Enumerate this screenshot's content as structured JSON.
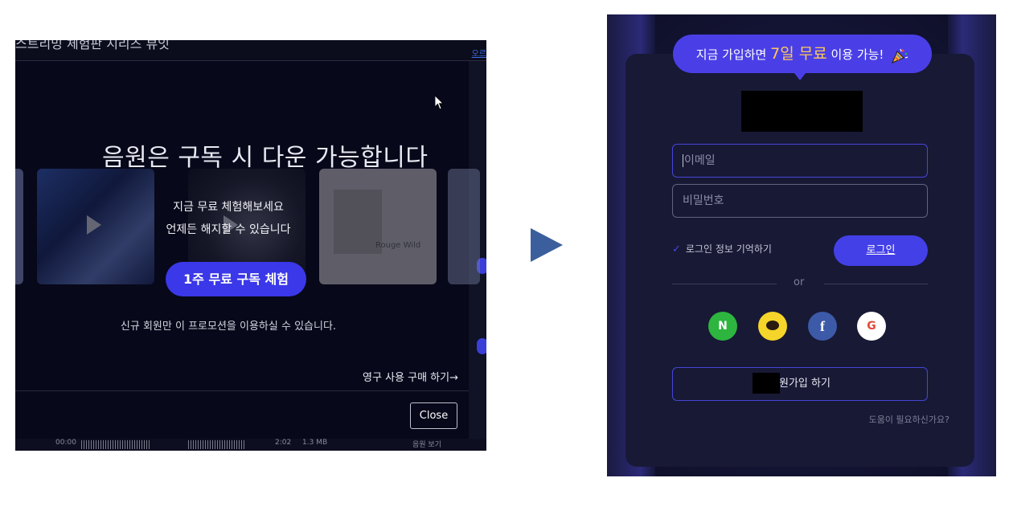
{
  "left_panel": {
    "top_title": "스트리밍 체험판 시리즈 뷰잇",
    "side_link": "오르",
    "headline": "음원은 구독 시 다운 가능합니다",
    "subtext_1": "지금 무료 체험해보세요",
    "subtext_2": "언제든 해지할 수 있습니다",
    "trial_button": "1주 무료 구독 체험",
    "promo_note": "신규 회원만 이 프로모션을 이용하실 수 있습니다.",
    "buy_link": "영구 사용 구매 하기→",
    "close_button": "Close",
    "album_3_label": "Rouge Wild",
    "bottom_time_left": "00:00",
    "bottom_time_mid": "2:02",
    "bottom_size": "1.3 MB",
    "bottom_right": "음원 보기"
  },
  "right_panel": {
    "promo_prefix": "지금 가입하면 ",
    "promo_highlight": "7일 무료",
    "promo_suffix": " 이용 가능!",
    "email_placeholder": "이메일",
    "password_placeholder": "비밀번호",
    "remember_label": "로그인 정보 기억하기",
    "login_button": "로그인",
    "or_text": "or",
    "social": {
      "naver": "N",
      "facebook": "f",
      "google": "G"
    },
    "signup_button": "회원가입 하기",
    "help_link": "도움이 필요하신가요?"
  },
  "colors": {
    "accent": "#4340e8",
    "highlight": "#ffc95a",
    "naver": "#2db53f",
    "kakao": "#f5d52a",
    "facebook": "#3c5aa8"
  },
  "icons": [
    "cursor-icon",
    "play-icon",
    "arrow-right-icon",
    "check-icon",
    "party-popper-icon",
    "naver-icon",
    "kakao-icon",
    "facebook-icon",
    "google-icon"
  ]
}
